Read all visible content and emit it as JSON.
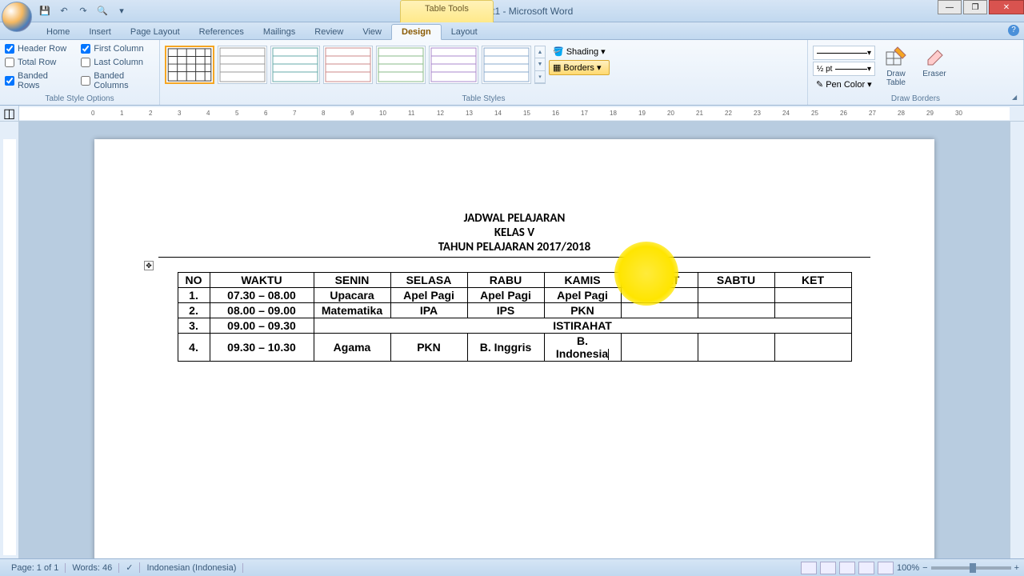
{
  "title": "Document1 - Microsoft Word",
  "table_tools": "Table Tools",
  "tabs": [
    "Home",
    "Insert",
    "Page Layout",
    "References",
    "Mailings",
    "Review",
    "View",
    "Design",
    "Layout"
  ],
  "active_tab": "Design",
  "groups": {
    "table_style_options": {
      "label": "Table Style Options",
      "items": {
        "header_row": {
          "label": "Header Row",
          "checked": true
        },
        "total_row": {
          "label": "Total Row",
          "checked": false
        },
        "banded_rows": {
          "label": "Banded Rows",
          "checked": true
        },
        "first_column": {
          "label": "First Column",
          "checked": true
        },
        "last_column": {
          "label": "Last Column",
          "checked": false
        },
        "banded_columns": {
          "label": "Banded Columns",
          "checked": false
        }
      }
    },
    "table_styles": {
      "label": "Table Styles",
      "shading": "Shading",
      "borders": "Borders"
    },
    "draw_borders": {
      "label": "Draw Borders",
      "weight": "½ pt",
      "pen_color": "Pen Color",
      "draw_table": "Draw\nTable",
      "eraser": "Eraser"
    }
  },
  "document": {
    "heading1": "JADWAL PELAJARAN",
    "heading2": "KELAS V",
    "heading3": "TAHUN PELAJARAN 2017/2018",
    "columns": [
      "NO",
      "WAKTU",
      "SENIN",
      "SELASA",
      "RABU",
      "KAMIS",
      "JUM'AT",
      "SABTU",
      "KET"
    ],
    "rows": [
      {
        "no": "1.",
        "waktu": "07.30 – 08.00",
        "cells": [
          "Upacara",
          "Apel Pagi",
          "Apel Pagi",
          "Apel Pagi",
          "",
          "",
          ""
        ]
      },
      {
        "no": "2.",
        "waktu": "08.00 – 09.00",
        "cells": [
          "Matematika",
          "IPA",
          "IPS",
          "PKN",
          "",
          "",
          ""
        ]
      },
      {
        "no": "3.",
        "waktu": "09.00 – 09.30",
        "merged": "ISTIRAHAT"
      },
      {
        "no": "4.",
        "waktu": "09.30 – 10.30",
        "cells": [
          "Agama",
          "PKN",
          "B. Inggris",
          "B. Indonesia",
          "",
          "",
          ""
        ]
      }
    ]
  },
  "status": {
    "page": "Page: 1 of 1",
    "words": "Words: 46",
    "language": "Indonesian (Indonesia)",
    "zoom": "100%"
  }
}
